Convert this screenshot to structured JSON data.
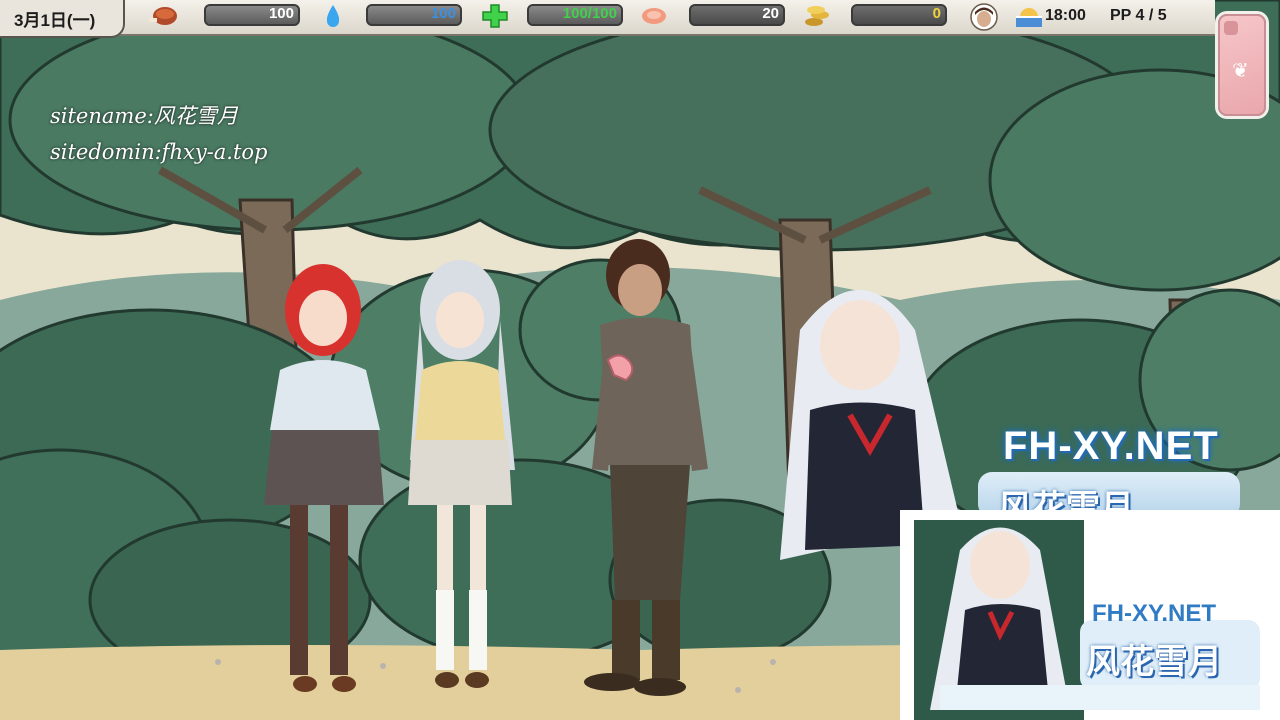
{
  "hud": {
    "date": "3月1日(一)",
    "food": {
      "icon": "roast-meat-icon",
      "value": "100",
      "level": 1.0,
      "color": "#ffffff"
    },
    "water": {
      "icon": "water-drop-icon",
      "value": "100",
      "level": 1.0,
      "color": "#3d8fe0"
    },
    "health": {
      "icon": "health-cross-icon",
      "value": "100/100",
      "level": 1.0,
      "color": "#3fd24a"
    },
    "meat": {
      "icon": "raw-meat-icon",
      "value": "20"
    },
    "money": {
      "icon": "coin-stack-icon",
      "value": "0",
      "color": "#f0d23a"
    },
    "time": {
      "icon": "sunset-icon",
      "value": "18:00"
    },
    "pp": "PP 4 / 5"
  },
  "phone": {
    "icon": "wing-icon"
  },
  "watermark": {
    "sitename": "sitename:风花雪月",
    "sitedomain": "sitedomin:fhxy-a.top",
    "brand": "FH-XY.NET",
    "brand_cn": "风花雪月",
    "inset_brand": "FH-XY.NET",
    "inset_cn": "风花雪月"
  },
  "colors": {
    "sky": "#eae4cf",
    "foliage_dark": "#3c6a55",
    "foliage": "#4e7f66",
    "ground": "#e3cf9b"
  }
}
